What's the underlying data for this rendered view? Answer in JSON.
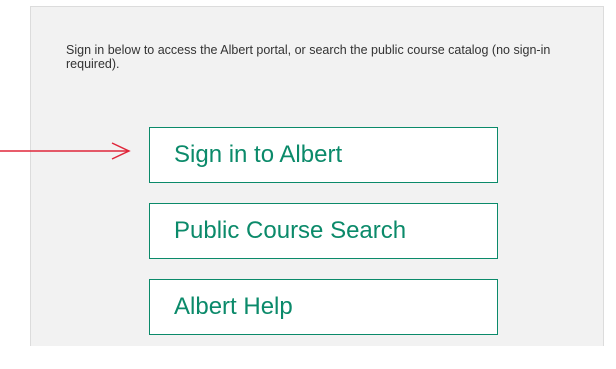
{
  "intro_text": "Sign in below to access the Albert portal, or search the public course catalog (no sign-in required).",
  "buttons": {
    "sign_in": "Sign in to Albert",
    "public_course_search": "Public Course Search",
    "albert_help": "Albert Help"
  },
  "colors": {
    "accent": "#0b8a6a",
    "panel_bg": "#f2f2f2",
    "annotation_arrow": "#e0263a"
  },
  "annotation": {
    "icon": "right-arrow-icon"
  }
}
